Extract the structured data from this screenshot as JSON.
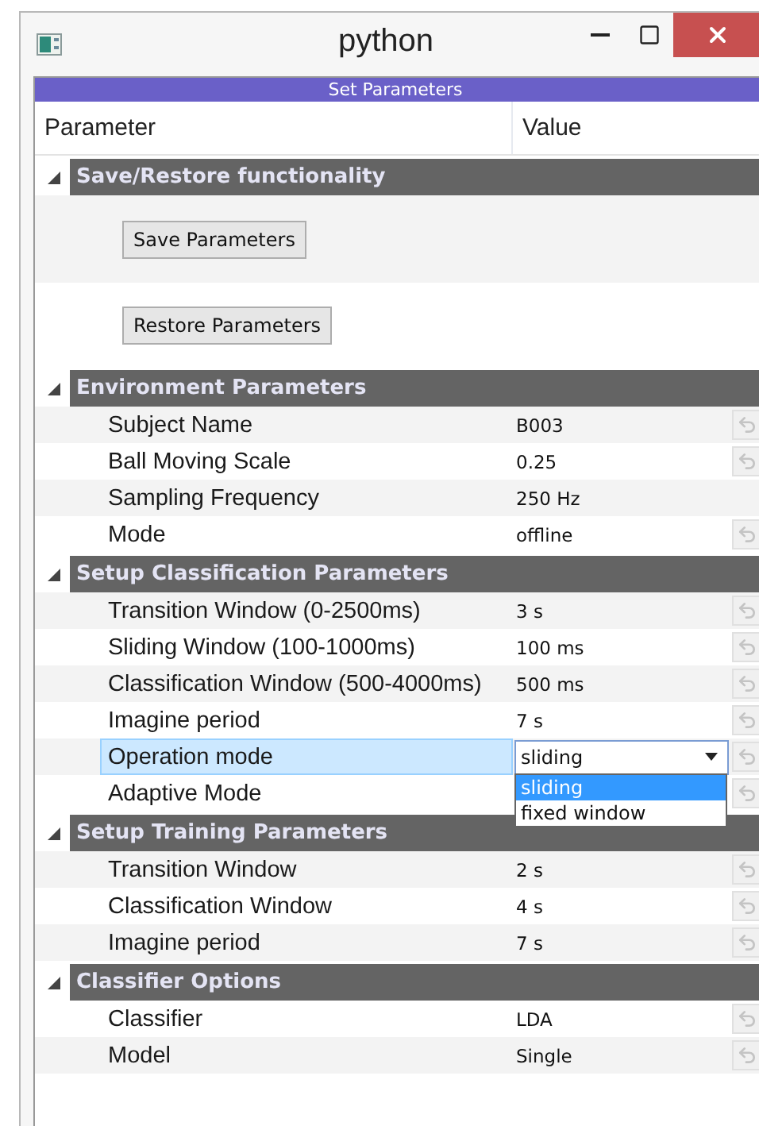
{
  "window": {
    "title": "python"
  },
  "panel_title": "Set Parameters",
  "columns": [
    "Parameter",
    "Value"
  ],
  "groups": [
    {
      "title": "Save/Restore functionality",
      "expanded": true,
      "items": [
        {
          "kind": "button",
          "label": "Save Parameters"
        },
        {
          "kind": "button",
          "label": "Restore Parameters"
        }
      ]
    },
    {
      "title": "Environment Parameters",
      "expanded": true,
      "items": [
        {
          "kind": "text",
          "label": "Subject Name",
          "value": "B003",
          "resettable": true,
          "selected": false
        },
        {
          "kind": "text",
          "label": "Ball Moving Scale",
          "value": "0.25",
          "resettable": true,
          "selected": false
        },
        {
          "kind": "text",
          "label": "Sampling Frequency",
          "value": "250 Hz",
          "resettable": false,
          "selected": false
        },
        {
          "kind": "text",
          "label": "Mode",
          "value": "offline",
          "resettable": true,
          "selected": false
        }
      ]
    },
    {
      "title": "Setup Classification Parameters",
      "expanded": true,
      "items": [
        {
          "kind": "text",
          "label": "Transition Window (0-2500ms)",
          "value": "3 s",
          "resettable": true,
          "selected": false
        },
        {
          "kind": "text",
          "label": "Sliding Window (100-1000ms)",
          "value": "100 ms",
          "resettable": true,
          "selected": false
        },
        {
          "kind": "text",
          "label": "Classification Window (500-4000ms)",
          "value": "500 ms",
          "resettable": true,
          "selected": false
        },
        {
          "kind": "text",
          "label": "Imagine period",
          "value": "7 s",
          "resettable": true,
          "selected": false
        },
        {
          "kind": "combo",
          "label": "Operation mode",
          "value": "sliding",
          "resettable": true,
          "selected": true,
          "open": true,
          "options": [
            {
              "label": "sliding",
              "selected": true
            },
            {
              "label": "fixed window",
              "selected": false
            }
          ]
        },
        {
          "kind": "text",
          "label": "Adaptive Mode",
          "resettable": true,
          "selected": false
        }
      ]
    },
    {
      "title": "Setup Training Parameters",
      "expanded": true,
      "items": [
        {
          "kind": "text",
          "label": "Transition Window",
          "value": "2 s",
          "resettable": true,
          "selected": false
        },
        {
          "kind": "text",
          "label": "Classification Window",
          "value": "4 s",
          "resettable": true,
          "selected": false
        },
        {
          "kind": "text",
          "label": "Imagine period",
          "value": "7 s",
          "resettable": true,
          "selected": false
        }
      ]
    },
    {
      "title": "Classifier Options",
      "expanded": true,
      "items": [
        {
          "kind": "text",
          "label": "Classifier",
          "value": "LDA",
          "resettable": true,
          "selected": false
        },
        {
          "kind": "text",
          "label": "Model",
          "value": "Single",
          "resettable": true,
          "selected": false
        }
      ]
    }
  ]
}
